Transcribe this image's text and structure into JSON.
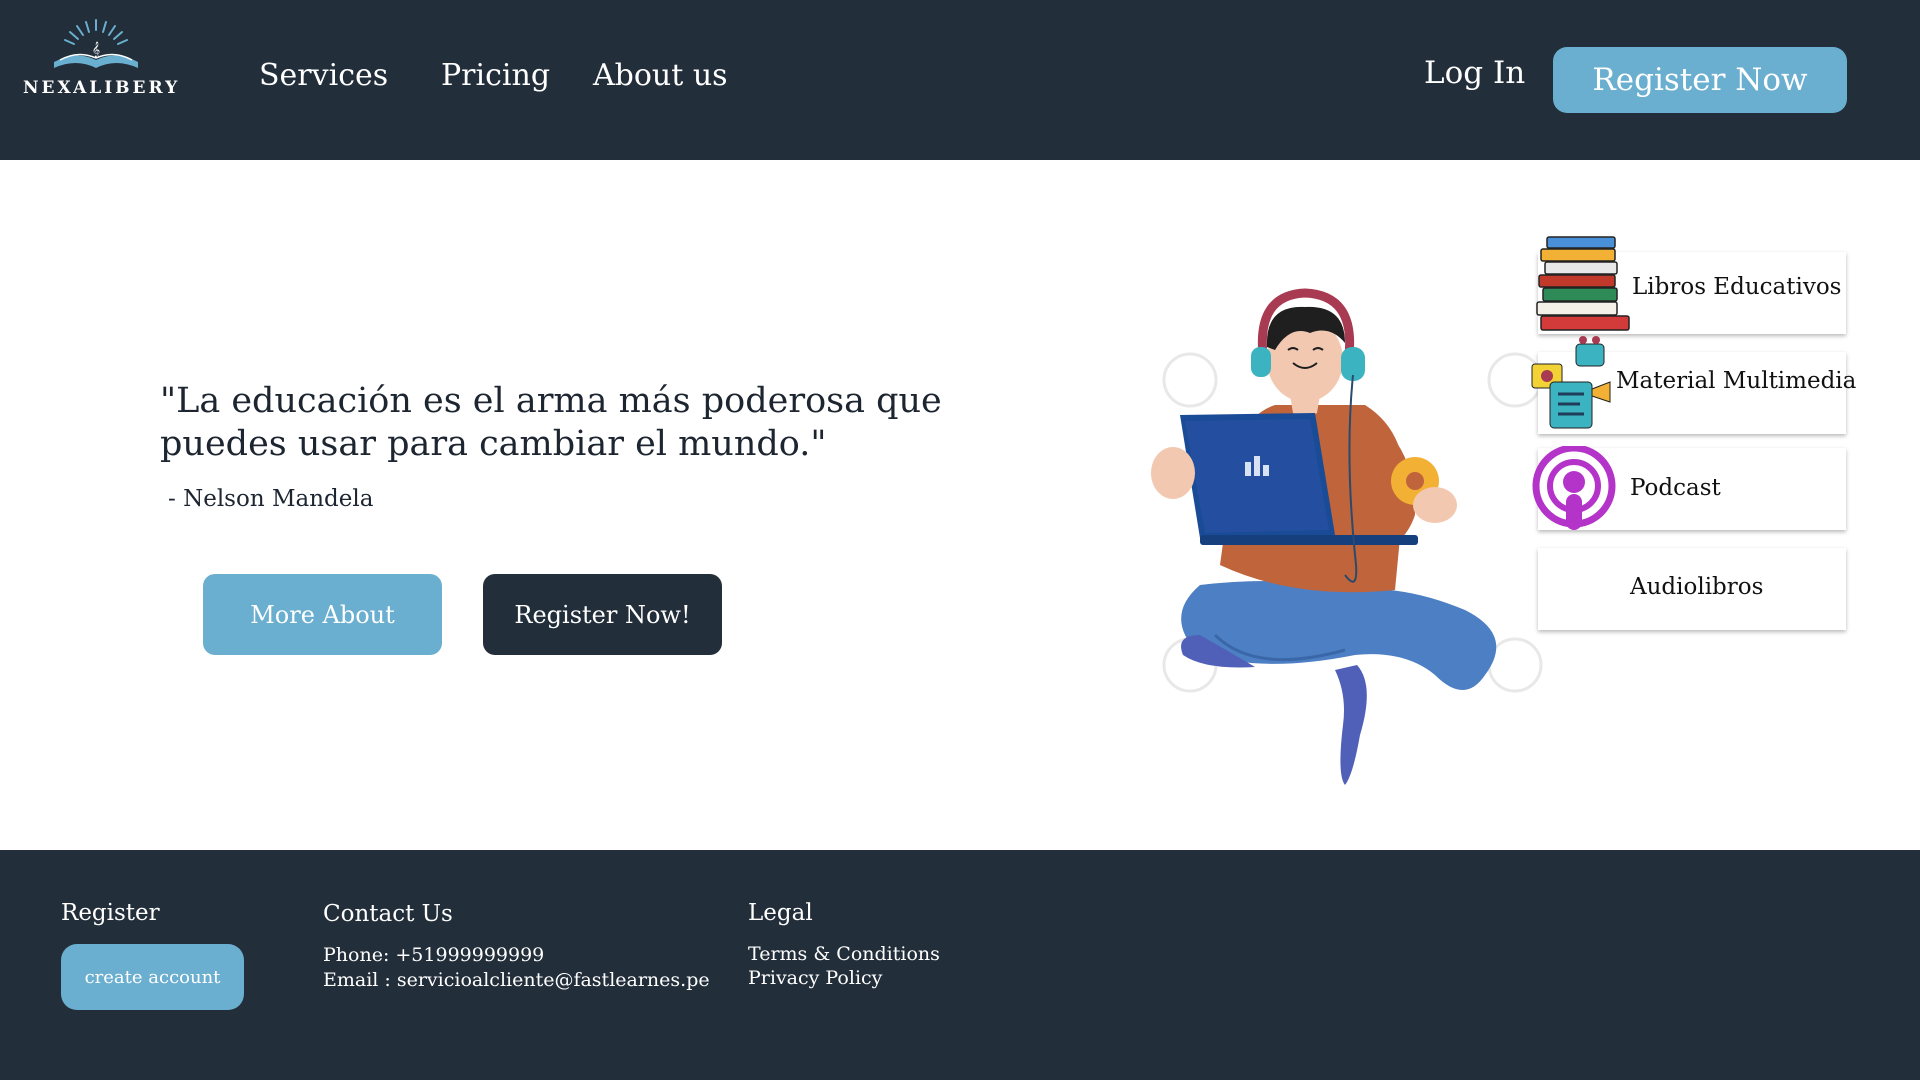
{
  "header": {
    "logo_text": "NEXALIBERY",
    "nav": [
      "Services",
      "Pricing",
      "About us"
    ],
    "login_label": "Log In",
    "register_label": "Register Now"
  },
  "hero": {
    "quote_line1": "\"La educación es el arma más poderosa que",
    "quote_line2": "puedes usar para cambiar el mundo.\"",
    "author": "- Nelson Mandela",
    "more_label": "More About",
    "register_label": "Register Now!"
  },
  "categories": [
    {
      "label": "Libros Educativos",
      "icon": "books-stack-icon"
    },
    {
      "label": "Material Multimedia",
      "icon": "multimedia-icon"
    },
    {
      "label": "Podcast",
      "icon": "podcast-icon"
    },
    {
      "label": "Audiolibros",
      "icon": ""
    }
  ],
  "footer": {
    "register_heading": "Register",
    "create_label": "create account",
    "contact_heading": "Contact Us",
    "phone": "Phone: +51999999999",
    "email": "Email : servicioalcliente@fastlearnes.pe",
    "legal_heading": "Legal",
    "terms": "Terms & Conditions",
    "privacy": "Privacy Policy"
  },
  "colors": {
    "navy": "#222e3a",
    "accent_blue": "#6aaed0",
    "white": "#ffffff"
  }
}
